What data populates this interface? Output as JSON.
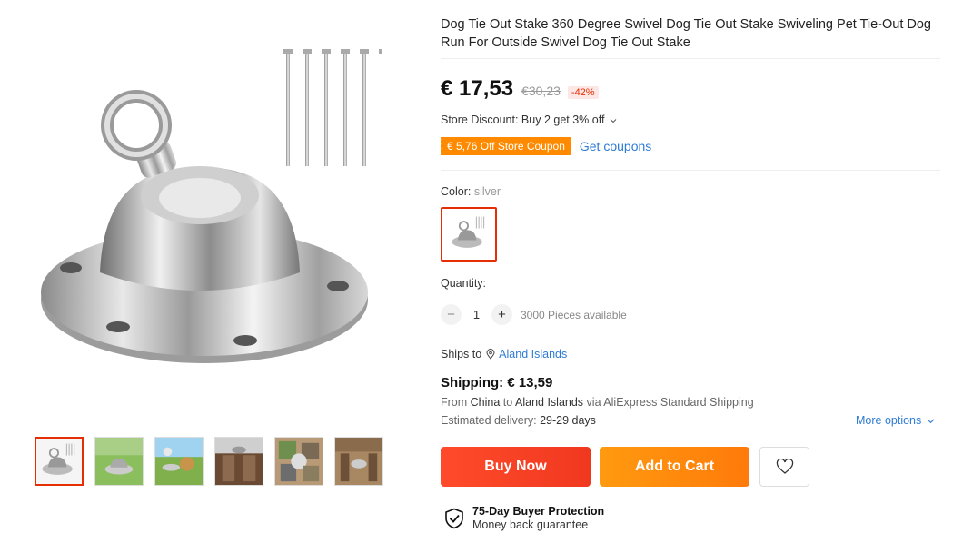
{
  "product": {
    "title": "Dog Tie Out Stake 360 Degree Swivel Dog Tie Out Stake Swiveling Pet Tie-Out Dog Run For Outside Swivel Dog Tie Out Stake",
    "price": "€ 17,53",
    "old_price": "€30,23",
    "discount": "-42%"
  },
  "store_discount": "Store Discount: Buy 2 get 3% off",
  "coupon": {
    "label": "€ 5,76 Off Store Coupon",
    "link": "Get coupons"
  },
  "color": {
    "label": "Color: ",
    "value": "silver"
  },
  "quantity": {
    "label": "Quantity:",
    "minus": "−",
    "plus": "+",
    "value": "1",
    "available": "3000 Pieces available"
  },
  "shipping": {
    "ships_to_label": "Ships to",
    "destination": "Aland Islands",
    "title": "Shipping: € 13,59",
    "from_prefix": "From ",
    "from_country": "China",
    "to_word": " to ",
    "to_country": "Aland Islands",
    "via": " via AliExpress Standard Shipping",
    "delivery_prefix": "Estimated delivery: ",
    "delivery_days": "29-29 days",
    "more_options": "More options"
  },
  "actions": {
    "buy_now": "Buy Now",
    "add_to_cart": "Add to Cart"
  },
  "protection": {
    "title": "75-Day Buyer Protection",
    "subtitle": "Money back guarantee"
  },
  "colors": {
    "accent_red": "#e62e04",
    "buy_now": "#ff4b2b",
    "add_cart": "#ff8a00",
    "link": "#2e7bd6",
    "coupon_bg": "#ff8a00"
  },
  "icons": {
    "location": "location-pin-icon",
    "chevron": "chevron-down-icon",
    "wishlist": "heart-icon",
    "protection": "shield-check-icon"
  }
}
